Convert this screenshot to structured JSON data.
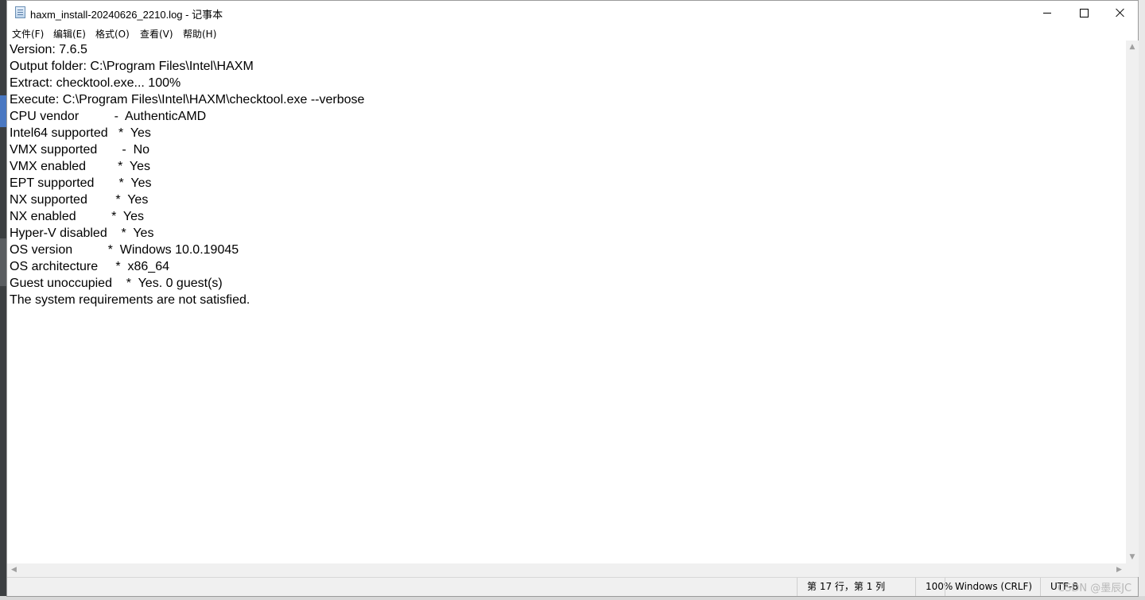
{
  "window": {
    "title": "haxm_install-20240626_2210.log - 记事本"
  },
  "menu": {
    "items": [
      "文件(F)",
      "编辑(E)",
      "格式(O)",
      "查看(V)",
      "帮助(H)"
    ]
  },
  "editor": {
    "lines": [
      "Version: 7.6.5",
      "Output folder: C:\\Program Files\\Intel\\HAXM",
      "Extract: checktool.exe... 100%",
      "Execute: C:\\Program Files\\Intel\\HAXM\\checktool.exe --verbose",
      "CPU vendor          -  AuthenticAMD",
      "Intel64 supported   *  Yes",
      "VMX supported       -  No",
      "VMX enabled         *  Yes",
      "EPT supported       *  Yes",
      "NX supported        *  Yes",
      "NX enabled          *  Yes",
      "Hyper-V disabled    *  Yes",
      "OS version          *  Windows 10.0.19045",
      "OS architecture     *  x86_64",
      "Guest unoccupied    *  Yes. 0 guest(s)",
      "The system requirements are not satisfied."
    ]
  },
  "status": {
    "position": "第 17 行，第 1 列",
    "zoom": "100%",
    "line_ending": "Windows (CRLF)",
    "encoding": "UTF-8"
  },
  "watermark": "CSDN @墨辰JC"
}
